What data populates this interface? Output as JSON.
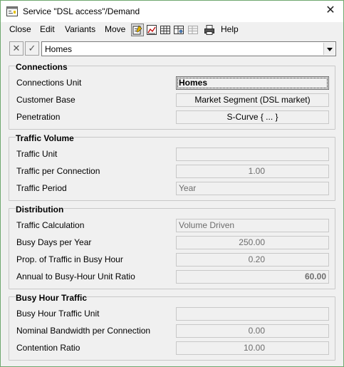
{
  "window": {
    "title": "Service \"DSL access\"/Demand",
    "close_glyph": "✕"
  },
  "menu": {
    "close": "Close",
    "edit": "Edit",
    "variants": "Variants",
    "move": "Move",
    "help": "Help"
  },
  "toolbar_icons": [
    "edit-form-icon",
    "chart-icon",
    "table-icon",
    "tree-grid-icon",
    "disabled-grid-icon",
    "print-icon"
  ],
  "editbar": {
    "cancel_glyph": "✕",
    "accept_glyph": "✓",
    "combo_value": "Homes"
  },
  "connections": {
    "title": "Connections",
    "unit_label": "Connections Unit",
    "unit_value": "Homes",
    "customer_base_label": "Customer Base",
    "customer_base_value": "Market Segment (DSL market)",
    "penetration_label": "Penetration",
    "penetration_value": "S-Curve { ... }"
  },
  "traffic_volume": {
    "title": "Traffic Volume",
    "unit_label": "Traffic Unit",
    "unit_value": "",
    "per_connection_label": "Traffic per Connection",
    "per_connection_value": "1.00",
    "period_label": "Traffic Period",
    "period_value": "Year"
  },
  "distribution": {
    "title": "Distribution",
    "calc_label": "Traffic Calculation",
    "calc_value": "Volume Driven",
    "busy_days_label": "Busy Days per Year",
    "busy_days_value": "250.00",
    "prop_busy_label": "Prop. of Traffic in Busy Hour",
    "prop_busy_value": "0.20",
    "ratio_label": "Annual to Busy-Hour Unit Ratio",
    "ratio_value": "60.00"
  },
  "busy_hour": {
    "title": "Busy Hour Traffic",
    "unit_label": "Busy Hour Traffic Unit",
    "unit_value": "",
    "bandwidth_label": "Nominal Bandwidth per Connection",
    "bandwidth_value": "0.00",
    "contention_label": "Contention Ratio",
    "contention_value": "10.00"
  },
  "colors": {
    "window_border": "#6fa86f",
    "dialog_bg": "#f0f0f0",
    "disabled_text": "#6d6d6d"
  }
}
